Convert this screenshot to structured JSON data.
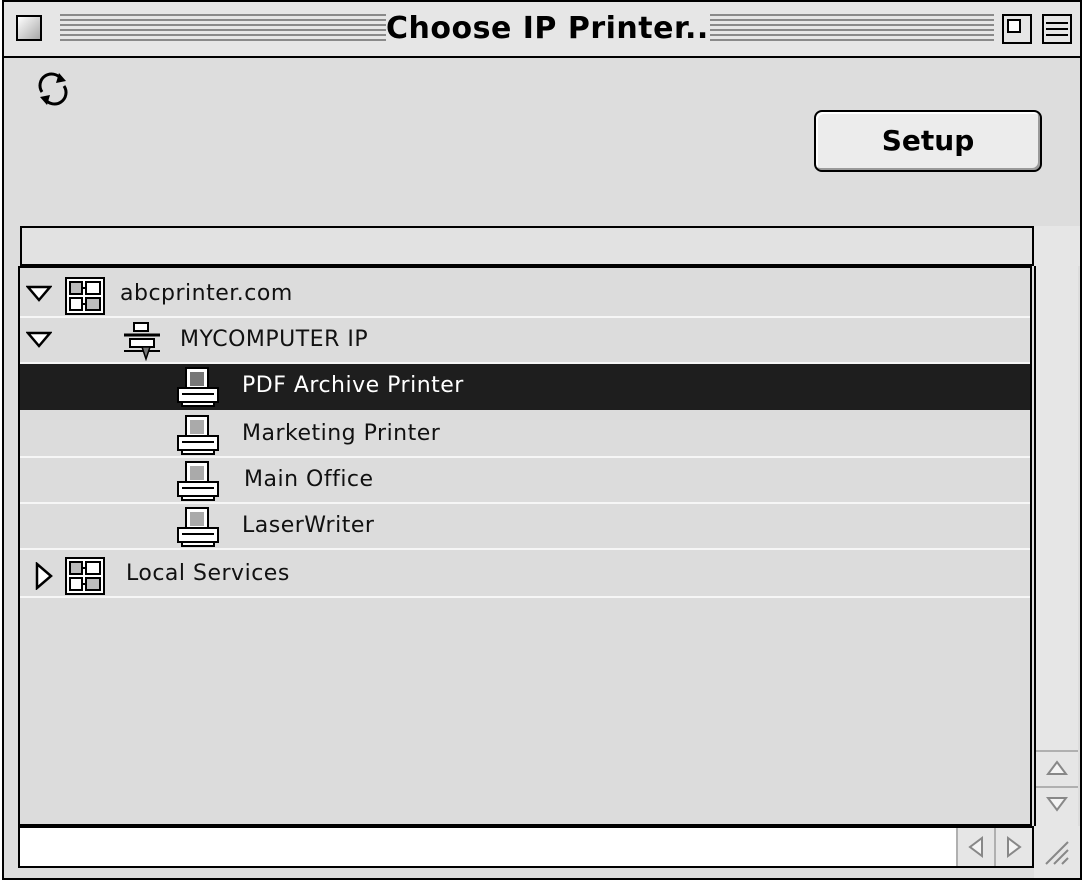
{
  "window": {
    "title": "Choose IP Printer..."
  },
  "toolbar": {
    "setup_label": "Setup",
    "path_value": ""
  },
  "tree": {
    "rows": [
      {
        "label": "abcprinter.com",
        "icon": "network-zone-icon",
        "disclosure": "expanded",
        "level": 0
      },
      {
        "label": "MYCOMPUTER IP",
        "icon": "computer-host-icon",
        "disclosure": "expanded",
        "level": 1
      },
      {
        "label": "PDF Archive Printer",
        "icon": "printer-icon",
        "disclosure": "none",
        "level": 2,
        "selected": true
      },
      {
        "label": "Marketing Printer",
        "icon": "printer-icon",
        "disclosure": "none",
        "level": 2
      },
      {
        "label": "Main Office",
        "icon": "printer-icon",
        "disclosure": "none",
        "level": 2
      },
      {
        "label": "LaserWriter",
        "icon": "printer-icon",
        "disclosure": "none",
        "level": 2
      },
      {
        "label": "Local Services",
        "icon": "network-zone-icon",
        "disclosure": "collapsed",
        "level": 0
      }
    ]
  },
  "colors": {
    "window_bg": "#dddddd",
    "selection_bg": "#1e1e1e",
    "selection_text": "#ffffff"
  }
}
